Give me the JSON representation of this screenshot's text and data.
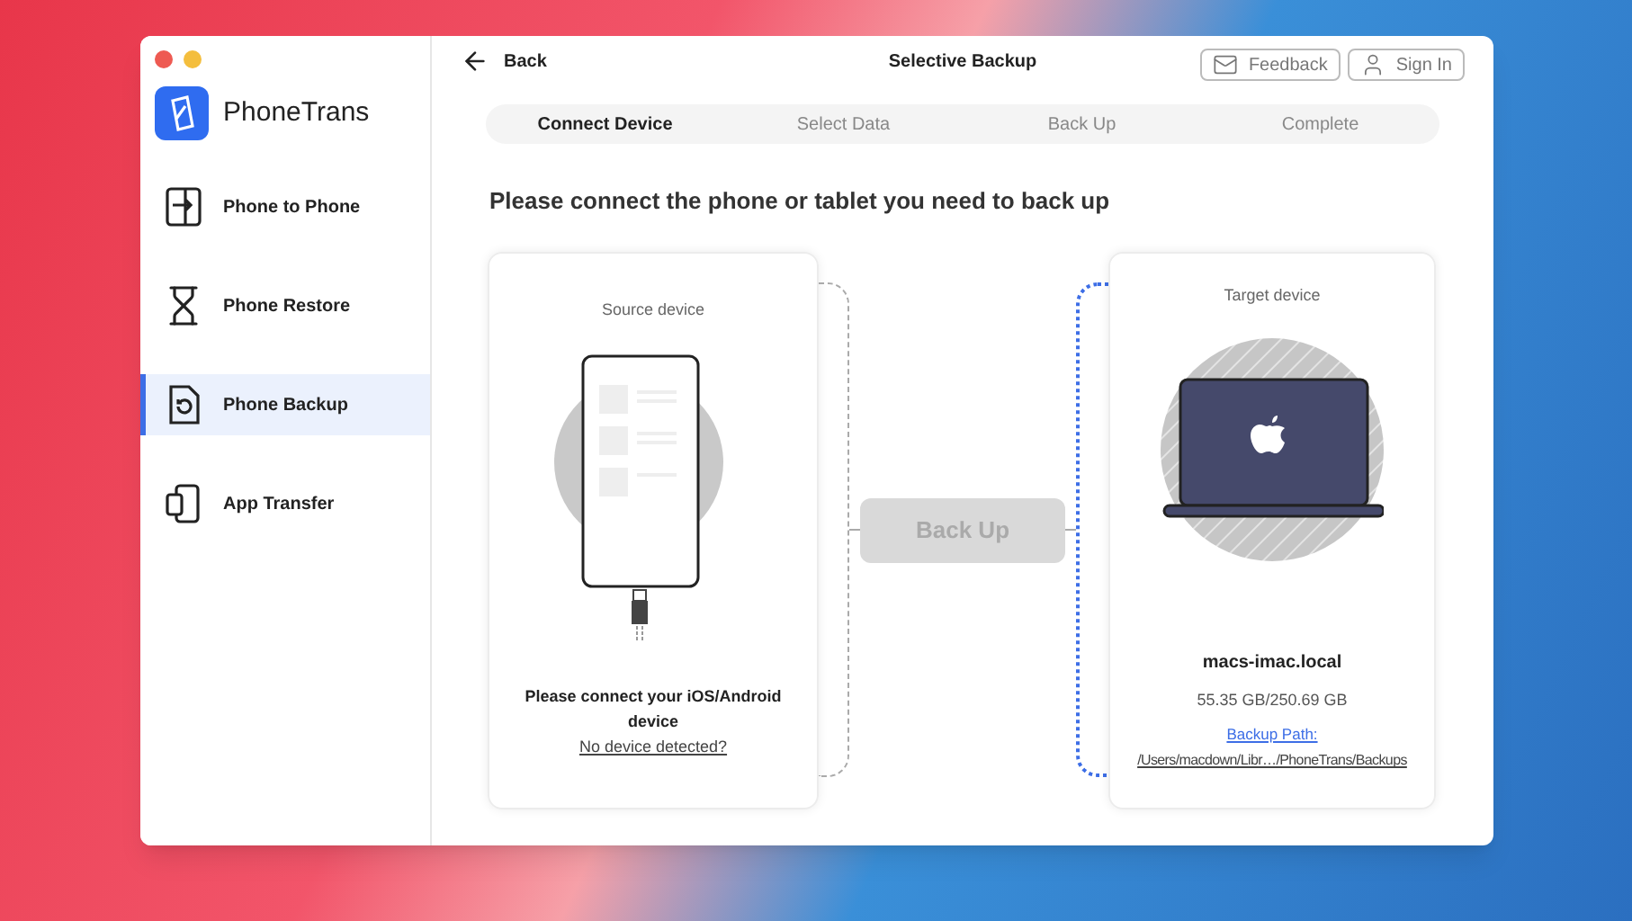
{
  "app": {
    "name": "PhoneTrans"
  },
  "sidebar": {
    "items": [
      {
        "label": "Phone to Phone",
        "kind": "transfer",
        "selected": false
      },
      {
        "label": "Phone Restore",
        "kind": "restore",
        "selected": false
      },
      {
        "label": "Phone Backup",
        "kind": "backup",
        "selected": true
      },
      {
        "label": "App Transfer",
        "kind": "apps",
        "selected": false
      }
    ]
  },
  "header": {
    "back": "Back",
    "title": "Selective Backup",
    "buttons": [
      {
        "label": "Feedback",
        "kind": "mail"
      },
      {
        "label": "Sign In",
        "kind": "user"
      }
    ]
  },
  "steps": [
    {
      "label": "Connect Device",
      "selected": true
    },
    {
      "label": "Select Data",
      "selected": false
    },
    {
      "label": "Back Up",
      "selected": false
    },
    {
      "label": "Complete",
      "selected": false
    }
  ],
  "heading": "Please connect the phone or tablet you need to back up",
  "source": {
    "title": "Source device",
    "message": "Please connect your iOS/Android device",
    "link": "No device detected?"
  },
  "action": {
    "label": "Back Up",
    "disabled": true
  },
  "target": {
    "title": "Target device",
    "name": "macs-imac.local",
    "storage": "55.35 GB/250.69 GB",
    "path_label": "Backup Path:",
    "path": "/Users/macdown/Libr…/PhoneTrans/Backups"
  }
}
